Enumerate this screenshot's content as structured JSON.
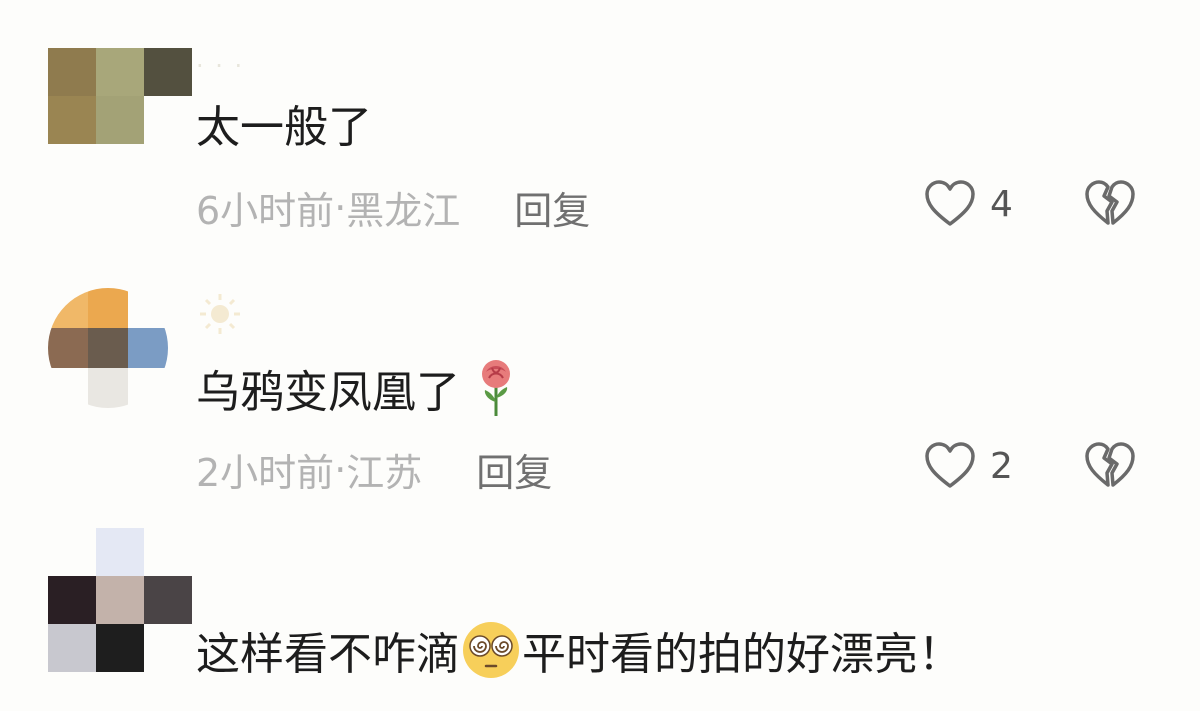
{
  "comments": [
    {
      "username": "· · ·",
      "text": "太一般了",
      "time": "6小时前",
      "location": "黑龙江",
      "reply_label": "回复",
      "likes": "4"
    },
    {
      "username": "",
      "text": "乌鸦变凤凰了",
      "time": "2小时前",
      "location": "江苏",
      "reply_label": "回复",
      "likes": "2",
      "emoji": "rose-icon"
    },
    {
      "username": "",
      "text_before": "这样看不咋滴",
      "text_after": "平时看的拍的好漂亮！",
      "emoji": "dizzy-face-icon"
    }
  ],
  "separator": " · ",
  "colors": {
    "background": "#fdfdfb",
    "text": "#1d1d1d",
    "meta": "#b3b3b3",
    "reply": "#707070",
    "icon_stroke": "#6a6a6a"
  }
}
